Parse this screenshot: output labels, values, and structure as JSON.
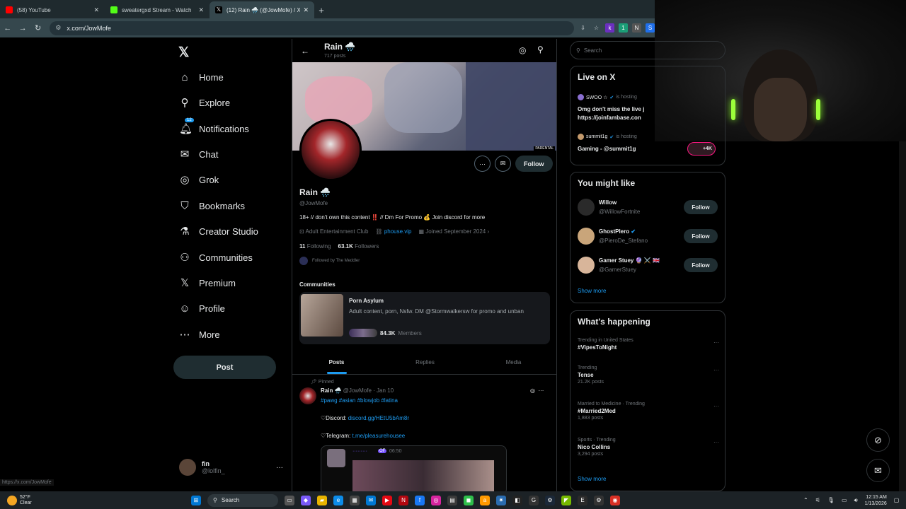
{
  "browser": {
    "tabs": [
      {
        "title": "(58) YouTube",
        "color": "#ff0000"
      },
      {
        "title": "sweatergxd Stream - Watch",
        "color": "#53fc18"
      },
      {
        "title": "(12) Rain 🌧️ (@JowMofe) / X",
        "color": "#ffffff"
      }
    ],
    "new_tab": "+",
    "url": "x.com/JowMofe"
  },
  "nav": {
    "logo": "𝕏",
    "items": [
      {
        "label": "Home",
        "icon": "⌂"
      },
      {
        "label": "Explore",
        "icon": "⚲"
      },
      {
        "label": "Notifications",
        "icon": "🔔︎",
        "badge": "12"
      },
      {
        "label": "Chat",
        "icon": "✉"
      },
      {
        "label": "Grok",
        "icon": "◎"
      },
      {
        "label": "Bookmarks",
        "icon": "⛉"
      },
      {
        "label": "Creator Studio",
        "icon": "⚗"
      },
      {
        "label": "Communities",
        "icon": "⚇"
      },
      {
        "label": "Premium",
        "icon": "𝕏"
      },
      {
        "label": "Profile",
        "icon": "☺"
      },
      {
        "label": "More",
        "icon": "⋯"
      }
    ],
    "post": "Post",
    "account": {
      "name": "fin",
      "handle": "@lolfin_",
      "more": "···"
    },
    "status_url": "https://x.com/JowMofe"
  },
  "profile": {
    "header_name": "Rain 🌧️",
    "header_posts": "717 posts",
    "banner_tag": "PARENTAL",
    "follow": "Follow",
    "name": "Rain 🌧️",
    "handle": "@JowMofe",
    "bio": "18+ // don't own this content ‼️ // Dm For Promo 💰 Join discord for more",
    "category": "Adult Entertainment Club",
    "link": "phouse.vip",
    "joined": "Joined September 2024",
    "following_count": "11",
    "following_label": "Following",
    "followers_count": "63.1K",
    "followers_label": "Followers",
    "followed_by": "Followed by The Meddler"
  },
  "communities": {
    "header": "Communities",
    "name": "Porn Asylum",
    "desc": "Adult content, porn, Nsfw. DM @Stormwalkersw for promo and unban",
    "members_count": "84.3K",
    "members_label": "Members"
  },
  "tabs": [
    "Posts",
    "Replies",
    "Media"
  ],
  "tweet": {
    "pinned": "Pinned",
    "name": "Rain 🌧️",
    "handle": "@JowMofe",
    "date": "· Jan 10",
    "hashtags": "#pawg #asian #blowjob #latina",
    "discord_label": "♡Discord: ",
    "discord_link": "discord.gg/HEtU5bAm8r",
    "telegram_label": "♡Telegram: ",
    "telegram_link": "t.me/pleasurehousee",
    "media_name": "·········",
    "media_badge": "OF",
    "media_time": "06:50"
  },
  "right": {
    "search_placeholder": "Search",
    "live": {
      "title": "Live on X",
      "items": [
        {
          "host": "SWOO ☆",
          "status": "is hosting",
          "text1": "Omg don't miss the live j",
          "text2": "https://joinfambase.con"
        },
        {
          "host": "summit1g",
          "status": "is hosting",
          "text1": "Gaming - @summit1g"
        }
      ],
      "pill": "+4K"
    },
    "suggest": {
      "title": "You might like",
      "items": [
        {
          "name": "Willow",
          "handle": "@WillowFortnite",
          "button": "Follow"
        },
        {
          "name": "GhostPlero",
          "handle": "@PieroDe_Stefano",
          "button": "Follow"
        },
        {
          "name": "Gamer Stuey 🔮 ⚔️ 🇬🇧",
          "handle": "@GamerStuey",
          "button": "Follow"
        }
      ],
      "show_more": "Show more"
    },
    "happening": {
      "title": "What's happening",
      "items": [
        {
          "context": "Trending in United States",
          "topic": "#VipesToNight",
          "posts": ""
        },
        {
          "context": "Trending",
          "topic": "Tense",
          "posts": "21.2K posts"
        },
        {
          "context": "Married to Medicine · Trending",
          "topic": "#Married2Med",
          "posts": "1,883 posts"
        },
        {
          "context": "Sports · Trending",
          "topic": "Nico Collins",
          "posts": "3,294 posts"
        }
      ],
      "show_more": "Show more"
    }
  },
  "taskbar": {
    "temp": "52°F",
    "cond": "Clear",
    "search": "Search",
    "time": "12:15 AM",
    "date": "1/13/2026"
  }
}
